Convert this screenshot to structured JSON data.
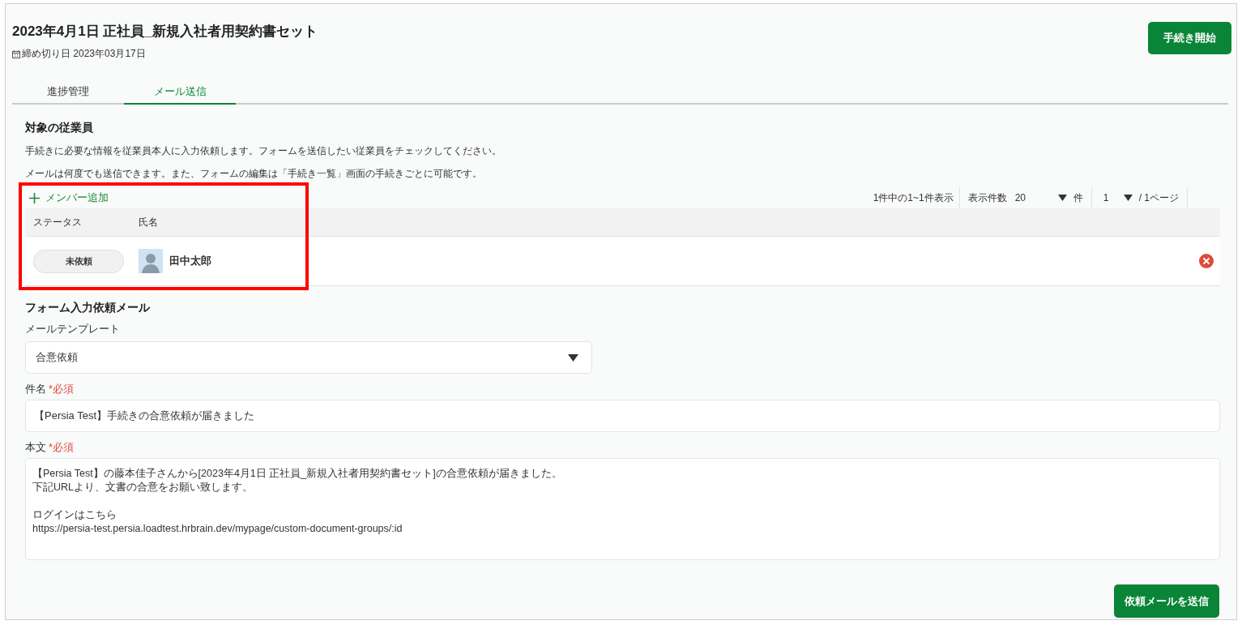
{
  "header": {
    "title": "2023年4月1日 正社員_新規入社者用契約書セット",
    "deadline": "締め切り日 2023年03月17日",
    "start_button": "手続き開始"
  },
  "tabs": [
    {
      "label": "進捗管理",
      "selected": false
    },
    {
      "label": "メール送信",
      "selected": true
    }
  ],
  "employees": {
    "title": "対象の従業員",
    "descriptions": [
      "手続きに必要な情報を従業員本人に入力依頼します。フォームを送信したい従業員をチェックしてください。",
      "メールは何度でも送信できます。また、フォームの編集は「手続き一覧」画面の手続きごとに可能です。"
    ],
    "add_member": "メンバー追加",
    "pagination": {
      "summary": "1件中の1~1件表示",
      "per_page_label": "表示件数",
      "per_page": "20",
      "per_page_unit": "件",
      "page": "1",
      "page_total": "/ 1ページ"
    },
    "columns": [
      "ステータス",
      "氏名"
    ],
    "rows": [
      {
        "status": "未依頼",
        "name": "田中太郎"
      }
    ]
  },
  "mail": {
    "title": "フォーム入力依頼メール",
    "template_label": "メールテンプレート",
    "template_value": "合意依頼",
    "subject_label": "件名",
    "subject_required": "*必須",
    "subject_value": "【Persia Test】手続きの合意依頼が届きました",
    "body_label": "本文",
    "body_required": "*必須",
    "body_paragraphs": [
      [
        "【Persia Test】の藤本佳子さんから[2023年4月1日 正社員_新規入社者用契約書セット]の合意依頼が届きました。",
        "下記URLより、文書の合意をお願い致します。"
      ],
      [
        "ログインはこちら",
        "https://persia-test.persia.loadtest.hrbrain.dev/mypage/custom-document-groups/:id"
      ]
    ],
    "send_button": "依頼メールを送信"
  }
}
